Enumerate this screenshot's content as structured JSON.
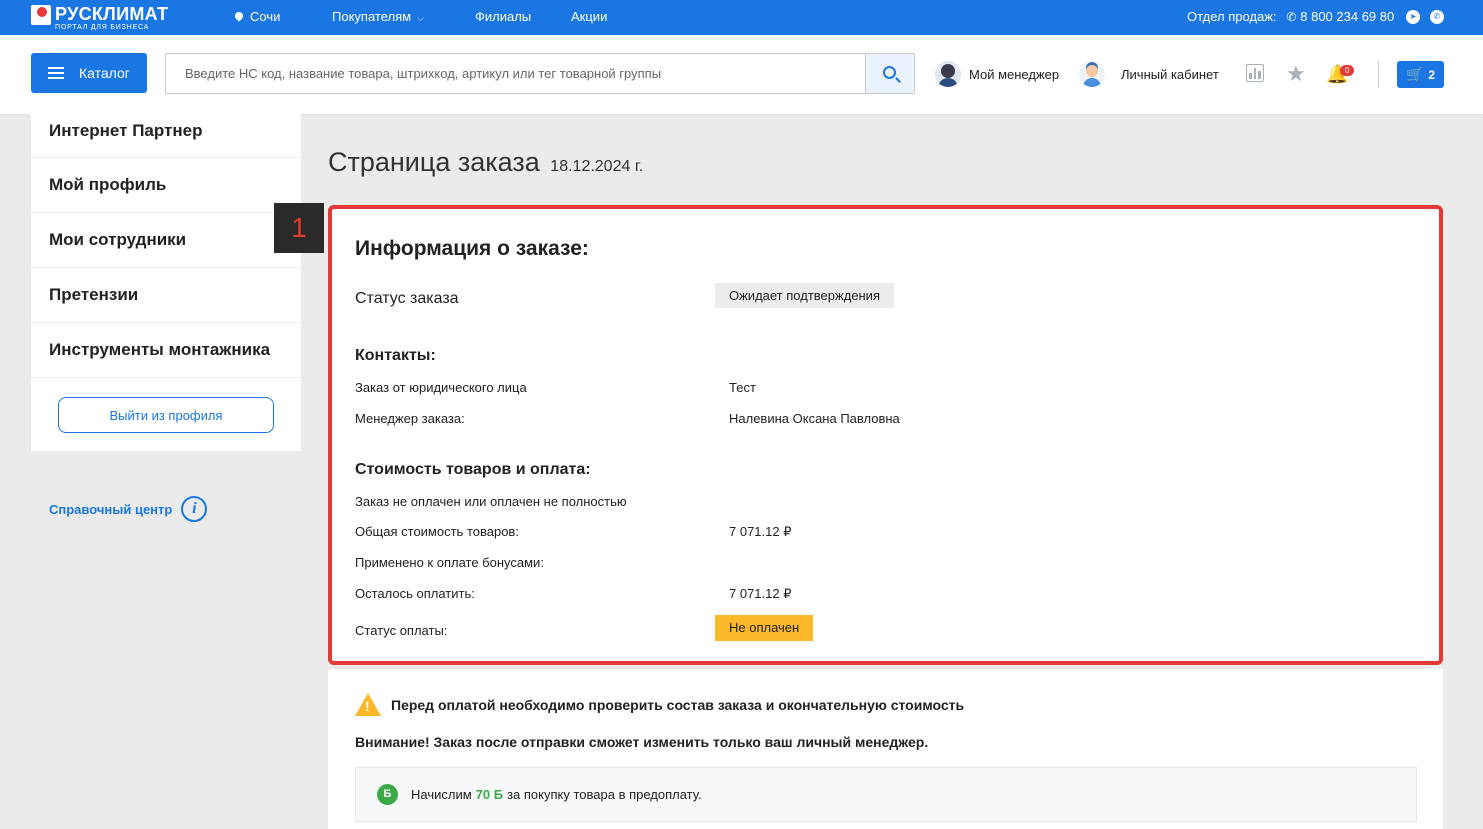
{
  "brand": {
    "name": "РУСКЛИМАТ",
    "tagline": "ПОРТАЛ ДЛЯ БИЗНЕСА"
  },
  "topbar": {
    "city": "Сочи",
    "nav": [
      "Покупателям",
      "Филиалы",
      "Акции"
    ],
    "sales_label": "Отдел продаж:",
    "phone": "8 800 234 69 80"
  },
  "header": {
    "catalog_label": "Каталог",
    "search_placeholder": "Введите НС код, название товара, штрихкод, артикул или тег товарной группы",
    "manager_label": "Мой менеджер",
    "account_label": "Личный кабинет",
    "notifications_count": "0",
    "cart_count": "2"
  },
  "sidebar": {
    "items": [
      "Интернет Партнер",
      "Мой профиль",
      "Мои сотрудники",
      "Претензии",
      "Инструменты монтажника"
    ],
    "logout_label": "Выйти из профиля",
    "help_label": "Справочный центр"
  },
  "page": {
    "title": "Страница заказа",
    "date": "18.12.2024 г.",
    "step_marker": "1"
  },
  "order": {
    "heading": "Информация о заказе:",
    "status_label": "Статус заказа",
    "status_value": "Ожидает подтверждения",
    "contacts_heading": "Контакты:",
    "legal_entity_label": "Заказ от юридического лица",
    "legal_entity_value": "Тест",
    "manager_label": "Менеджер заказа:",
    "manager_value": "Налевина Оксана Павловна",
    "payment_heading": "Стоимость товаров и оплата:",
    "payment_note": "Заказ не оплачен или оплачен не полностью",
    "total_label": "Общая стоимость товаров:",
    "total_value": "7 071.12 ₽",
    "bonus_label": "Применено к оплате бонусами:",
    "remaining_label": "Осталось оплатить:",
    "remaining_value": "7 071.12 ₽",
    "payment_status_label": "Статус оплаты:",
    "payment_status_value": "Не оплачен"
  },
  "notice": {
    "warning": "Перед оплатой необходимо проверить состав заказа и окончательную стоимость",
    "attention": "Внимание! Заказ после отправки сможет изменить только ваш личный менеджер.",
    "bonus_icon": "Б",
    "bonus_prefix": "Начислим",
    "bonus_value": "70 Б",
    "bonus_suffix": "за покупку товара в предоплату."
  },
  "colors": {
    "primary": "#1976e3",
    "highlight": "#e53935",
    "warning": "#fbb829",
    "bonus": "#3daa4a"
  }
}
